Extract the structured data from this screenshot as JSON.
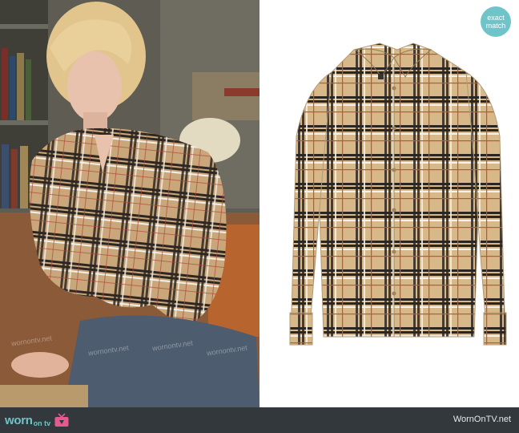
{
  "badge": {
    "line1": "exact",
    "line2": "match"
  },
  "footer": {
    "logo_worn": "worn",
    "logo_ontv": "on tv",
    "site_name": "WornOnTV.net"
  },
  "watermarks": [
    "wornontv.net",
    "wornontv.net",
    "wornontv.net",
    "wornontv.net"
  ],
  "colors": {
    "badge": "#6fc4c9",
    "footer_bg": "#33383d",
    "plaid_base": "#d7b888",
    "plaid_dark": "#2b2622",
    "plaid_red": "#d64a3a"
  }
}
